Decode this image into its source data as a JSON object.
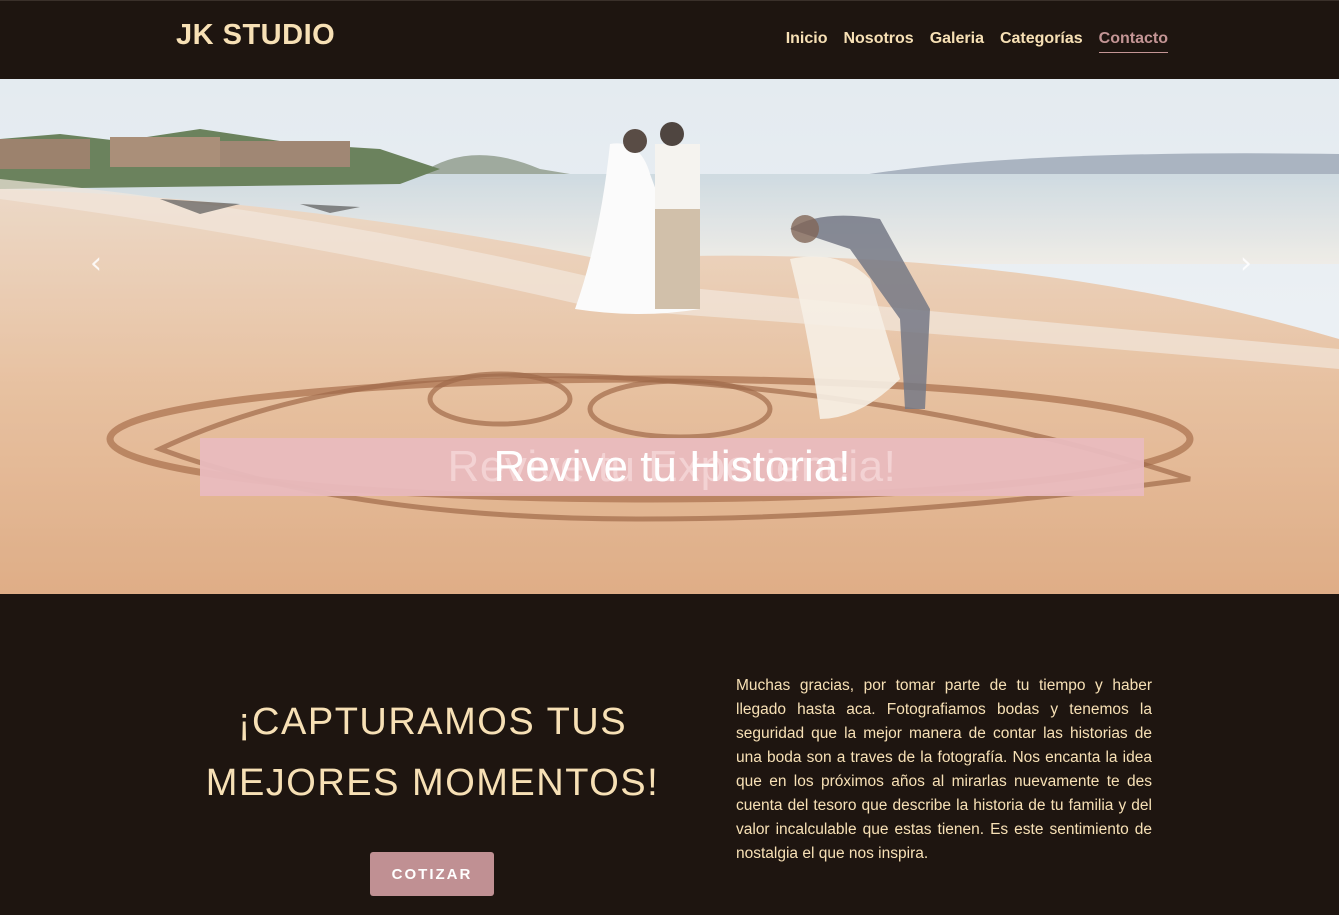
{
  "header": {
    "brand": "JK STUDIO",
    "nav": [
      {
        "label": "Inicio"
      },
      {
        "label": "Nosotros"
      },
      {
        "label": "Galeria"
      },
      {
        "label": "Categorías"
      },
      {
        "label": "Contacto"
      }
    ],
    "active_nav": "Contacto"
  },
  "hero": {
    "caption": "Revive tu Historia!",
    "caption_fading": "Revive tu Experiencia!",
    "prev_icon": "chevron-left-icon",
    "next_icon": "chevron-right-icon"
  },
  "main": {
    "headline": "¡CAPTURAMOS TUS MEJORES MOMENTOS!",
    "cta_label": "COTIZAR",
    "intro": "Muchas gracias, por tomar parte de tu tiempo y haber llegado hasta aca. Fotografiamos bodas y tenemos la seguridad que la mejor manera de contar las historias de una boda son a traves de la fotografía. Nos encanta la idea que en los próximos años al mirarlas nuevamente te des cuenta del tesoro que describe la historia de tu familia y del valor incalculable que estas tienen. Es este sentimiento de nostalgia el que nos inspira."
  },
  "colors": {
    "background": "#1e1510",
    "accent_text": "#f7e0b5",
    "active_link": "#c49595",
    "button": "#c09093",
    "caption_band": "#e9babe"
  }
}
